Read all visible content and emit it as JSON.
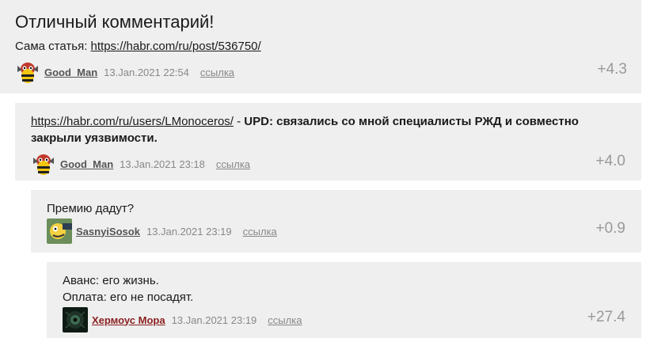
{
  "comments": [
    {
      "title": "Отличный комментарий!",
      "text_prefix": "Сама статья: ",
      "text_link": "https://habr.com/ru/post/536750/",
      "username": "Good_Man",
      "date": "13.Jan.2021 22:54",
      "link_label": "ссылка",
      "score": "+4.3",
      "avatar": "hornet-avatar-icon"
    },
    {
      "text_link": "https://habr.com/ru/users/LMonoceros/",
      "text_sep": " - ",
      "text_bold": "UPD: связались со мной специалисты РЖД и совместно закрыли уязвимости.",
      "username": "Good_Man",
      "date": "13.Jan.2021 23:18",
      "link_label": "ссылка",
      "score": "+4.0",
      "avatar": "hornet-avatar-icon"
    },
    {
      "text": "Премию дадут?",
      "username": "SasnyiSosok",
      "date": "13.Jan.2021 23:19",
      "link_label": "ссылка",
      "score": "+0.9",
      "avatar": "cartoon-avatar-icon"
    },
    {
      "text_line1": "Аванс: его жизнь.",
      "text_line2": "Оплата: его не посадят.",
      "username": "Хермоус Мора",
      "date": "13.Jan.2021 23:19",
      "link_label": "ссылка",
      "score": "+27.4",
      "avatar": "eye-avatar-icon"
    }
  ],
  "colors": {
    "comment_bg": "#efefef",
    "username": "#555555",
    "username_highlight": "#8a1f1f",
    "meta": "#888888",
    "score": "#999999"
  }
}
